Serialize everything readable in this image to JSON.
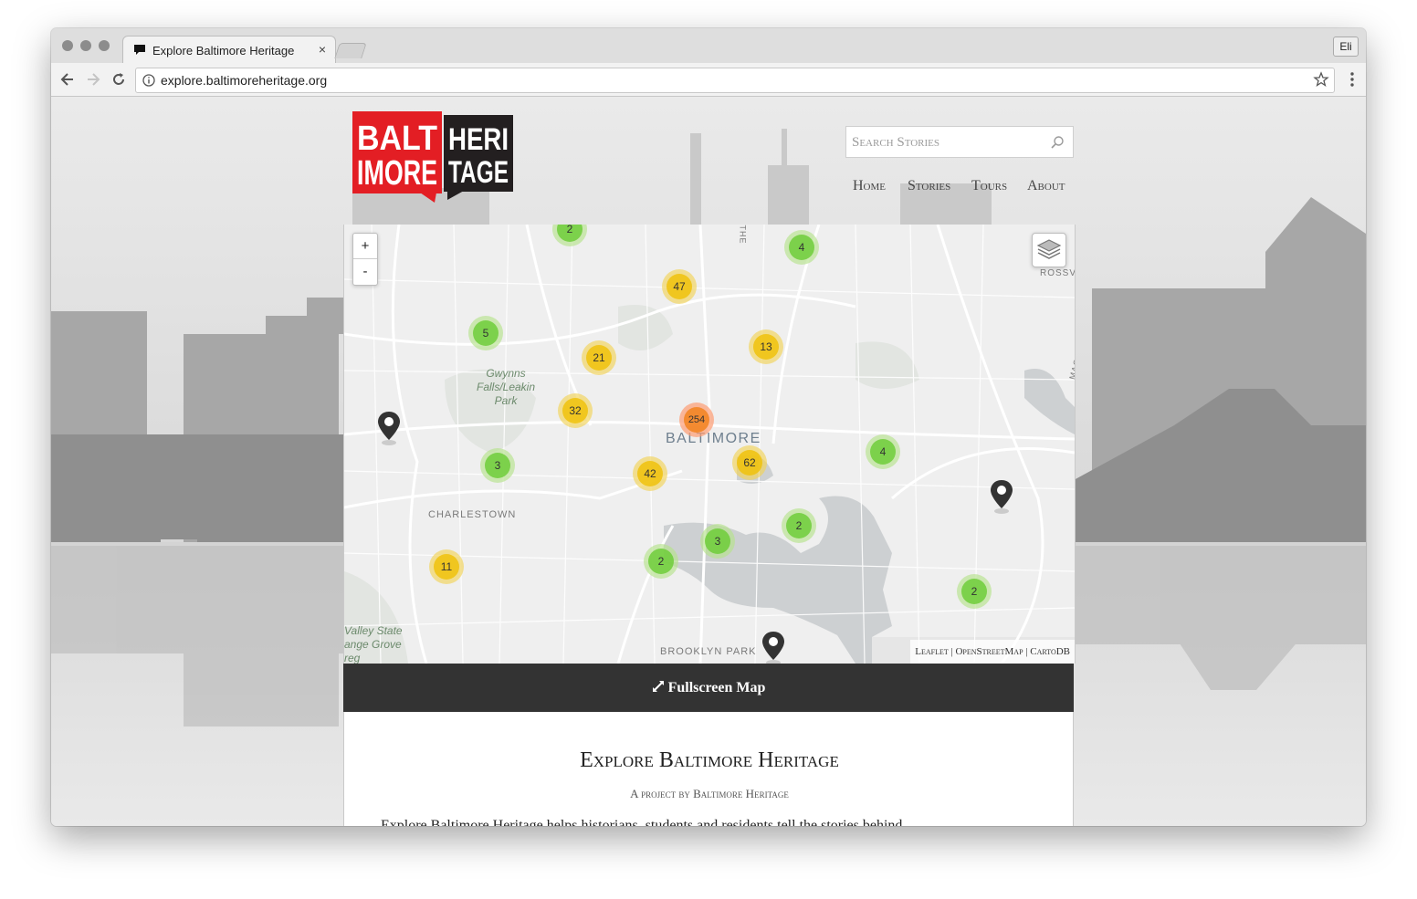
{
  "browser": {
    "tab_title": "Explore Baltimore Heritage",
    "tab_close": "×",
    "profile": "Eli",
    "url": "explore.baltimoreheritage.org"
  },
  "logo": {
    "line1_left": "BALT",
    "line2_left": "IMORE",
    "line1_right": "HERI",
    "line2_right": "TAGE",
    "colors": {
      "red": "#e31e24",
      "dark": "#231f20"
    }
  },
  "search": {
    "placeholder": "Search Stories",
    "icon": "search-icon"
  },
  "nav": {
    "items": [
      {
        "label": "Home"
      },
      {
        "label": "Stories"
      },
      {
        "label": "Tours"
      },
      {
        "label": "About"
      }
    ]
  },
  "map": {
    "zoom_in": "+",
    "zoom_out": "-",
    "clusters": [
      {
        "count": "2",
        "level": "small"
      },
      {
        "count": "4",
        "level": "small"
      },
      {
        "count": "47",
        "level": "medium"
      },
      {
        "count": "5",
        "level": "small"
      },
      {
        "count": "21",
        "level": "medium"
      },
      {
        "count": "13",
        "level": "medium"
      },
      {
        "count": "32",
        "level": "medium"
      },
      {
        "count": "254",
        "level": "large"
      },
      {
        "count": "62",
        "level": "medium"
      },
      {
        "count": "4",
        "level": "small"
      },
      {
        "count": "3",
        "level": "small"
      },
      {
        "count": "42",
        "level": "medium"
      },
      {
        "count": "2",
        "level": "small"
      },
      {
        "count": "3",
        "level": "small"
      },
      {
        "count": "2",
        "level": "small"
      },
      {
        "count": "11",
        "level": "medium"
      },
      {
        "count": "2",
        "level": "small"
      }
    ],
    "labels": {
      "city": "BALTIMORE",
      "charlestown": "CHARLESTOWN",
      "brooklyn_park": "BROOKLYN PARK",
      "rossville": "ROSSVI",
      "the": "THE",
      "mace": "MACE",
      "gwynns_1": "Gwynns",
      "gwynns_2": "Falls/Leakin",
      "gwynns_3": "Park",
      "valley_1": "Valley State",
      "valley_2": "ange Grove",
      "valley_3": "reg"
    },
    "attribution": "Leaflet | OpenStreetMap | CartoDB"
  },
  "fullscreen": {
    "icon": "expand-icon",
    "label": "Fullscreen Map"
  },
  "intro": {
    "title": "Explore Baltimore Heritage",
    "subtitle": "A project by Baltimore Heritage",
    "body": "Explore Baltimore Heritage helps historians, students and residents tell the stories behind"
  }
}
